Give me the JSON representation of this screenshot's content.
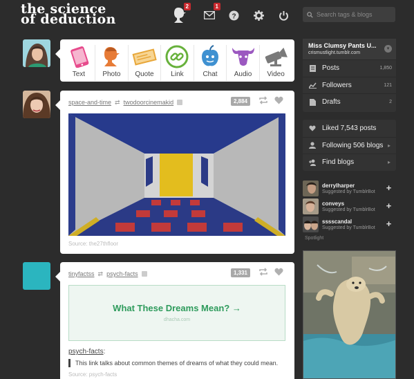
{
  "logo": {
    "line1": "the  science",
    "line2": "of deduction"
  },
  "header": {
    "icons": [
      {
        "name": "dashboard-icon",
        "badge": "2"
      },
      {
        "name": "mail-icon",
        "badge": "1"
      },
      {
        "name": "help-icon",
        "badge": ""
      },
      {
        "name": "gear-icon",
        "badge": ""
      },
      {
        "name": "power-icon",
        "badge": ""
      }
    ],
    "search_placeholder": "Search tags & blogs"
  },
  "composer": {
    "types": [
      {
        "key": "text",
        "label": "Text",
        "color": "#e74b8c"
      },
      {
        "key": "photo",
        "label": "Photo",
        "color": "#e77b36"
      },
      {
        "key": "quote",
        "label": "Quote",
        "color": "#e8a73a"
      },
      {
        "key": "link",
        "label": "Link",
        "color": "#67b13b"
      },
      {
        "key": "chat",
        "label": "Chat",
        "color": "#3f91d1"
      },
      {
        "key": "audio",
        "label": "Audio",
        "color": "#9b58c0"
      },
      {
        "key": "video",
        "label": "Video",
        "color": "#7a7a7a"
      }
    ]
  },
  "posts": [
    {
      "from": "space-and-time",
      "via": "twodoorcinemakid",
      "notes": "2,884",
      "source": "Source: the27thfloor"
    },
    {
      "from": "tinyfactss",
      "via": "psych-facts",
      "notes": "1,331",
      "link_title": "What These Dreams Mean? →",
      "link_domain": "dhacha.com",
      "author": "psych-facts",
      "author_suffix": ":",
      "quote": "This link talks about common themes of dreams of what they could mean.",
      "source": "Source: psych-facts"
    }
  ],
  "sidebar": {
    "blog_title": "Miss Clumsy Pants U...",
    "blog_url": "crismustlight.tumblr.com",
    "stats": [
      {
        "label": "Posts",
        "count": "1,850"
      },
      {
        "label": "Followers",
        "count": "121"
      },
      {
        "label": "Drafts",
        "count": "2"
      }
    ],
    "links": [
      {
        "label": "Liked 7,543 posts"
      },
      {
        "label": "Following 506 blogs"
      },
      {
        "label": "Find blogs"
      }
    ],
    "suggestions": [
      {
        "name": "derrylharper",
        "sub": "Suggested by TumblrBot"
      },
      {
        "name": "conveys",
        "sub": "Suggested by TumblrBot"
      },
      {
        "name": "sssscandal",
        "sub": "Suggested by TumblrBot"
      }
    ],
    "spotlight_label": "Spotlight"
  },
  "colors": {
    "background": "#2c2c2c",
    "link_green": "#2e9b5c",
    "badge_red": "#c8292e"
  }
}
